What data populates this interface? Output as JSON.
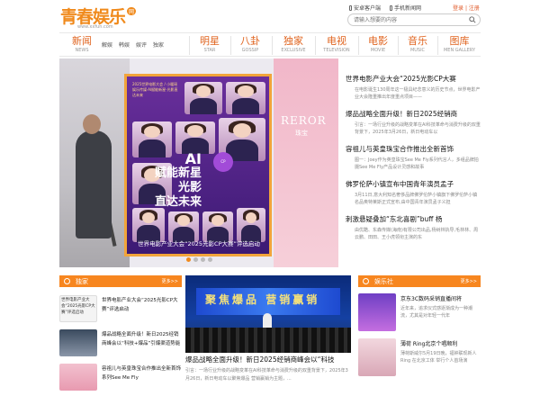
{
  "site": {
    "logo_text": "青春娱乐",
    "logo_badge": "网",
    "logo_url": "www.xxfun.com"
  },
  "topnav": {
    "android_client": "安卓客户端",
    "mobile_news": "手机新闻网",
    "login": "登录",
    "register": "注册"
  },
  "search": {
    "placeholder": "请输入想要的内容"
  },
  "mainnav": {
    "items": [
      {
        "zh": "新闻",
        "en": "NEWS"
      },
      {
        "zh": "明星",
        "en": "STAR"
      },
      {
        "zh": "八卦",
        "en": "GOSSIP"
      },
      {
        "zh": "独家",
        "en": "EXCLUSIVE"
      },
      {
        "zh": "电视",
        "en": "TELEVISION"
      },
      {
        "zh": "电影",
        "en": "MOVIE"
      },
      {
        "zh": "音乐",
        "en": "MUSIC"
      },
      {
        "zh": "图库",
        "en": "MEN GALLERY"
      }
    ],
    "subitems": [
      "解娱",
      "韩娱",
      "娱评",
      "独家"
    ]
  },
  "hero": {
    "poster_header": "2025世界电影大会 / 小暖瑶娱乐传媒·AI赋能新星·光影直达未来",
    "ai_line1": "AI",
    "ai_line2": "赋能新星",
    "ai_line3": "光影",
    "ai_line4": "直达未来",
    "right_logo": "REROR",
    "right_logo_sub": "珠宝",
    "caption": "世界电影产业大会“2025光影CP大赛”评选启动"
  },
  "news": [
    {
      "title": "世界电影产业大会“2025光影CP大赛",
      "desc": "在电影诞生130周年这一极具纪念意义的历史节点，世界电影产业大会隆重推出年度重点项目——"
    },
    {
      "title": "爆品战略全面升级！新日2025经销商",
      "desc": "引言：一场行业升级的战略变革在AI科技革命与消费升级的双重背景下，2025年3月26日，新日电动车以"
    },
    {
      "title": "容祖儿与英皇珠宝合作推出全新首饰",
      "desc": "图一：Joey作为英皇珠宝See Me Fly系列代言人，多组品牌拍摄See Me Fly产品设计灵感和故事"
    },
    {
      "title": "佛罗伦萨小镇宣布中国青年演员孟子",
      "desc": "3月11日,意大利知名奢侈品牌佛罗伦萨小镇旗下佛罗伦萨小镇名品奥特莱斯正式宣布,由中国青年演员孟子义担"
    },
    {
      "title": "刺激悬疑叠加“东北喜剧”buff 杨",
      "desc": "由优酷、东森传媒(海南)有限公司出品,杨树林执导,毛林林、周云鹏、田田、王小虎领衔主演的东"
    }
  ],
  "exclusive": {
    "title": "独家",
    "more": "更多>>",
    "items": [
      {
        "thumb_caption": "世界电影产业大会“2025光影CP大赛”评选启动",
        "title": "世界电影产业大会“2025光影CP大赛”评选启动"
      },
      {
        "thumb_caption": "",
        "title": "爆品战略全面升级！新日2025经销商峰会以“科技+爆品”引爆渠道势能"
      },
      {
        "thumb_caption": "",
        "title": "容祖儿与英皇珠宝合作推出全新首饰系列See Me Fly"
      }
    ]
  },
  "middle": {
    "stage_text": "聚焦爆品",
    "stage_text2": "营销赢销",
    "title": "爆品战略全面升级！新日2025经销商峰会以“科技",
    "desc": "引言：一场行业升级的战略变革在AI科技革命与消费升级的双重背景下，2025年3月26日，新日电动车以聚焦爆品 营销赢销为主题，..."
  },
  "fun": {
    "title": "娱乐社",
    "more": "更多>>",
    "items": [
      {
        "title": "京东3C数码采销直播间将",
        "desc": "近年来，追求仪式感逐渐成为一种潮流，尤其是对年轻一代年"
      },
      {
        "title": "薄荷 Ring北京个唱顺利",
        "desc": "薄荷斯威尔5月19日晚，福钟联现新人 Ring 在北京工体 举行个人首场演"
      }
    ]
  },
  "colors": {
    "accent": "#f08a1c",
    "panel_head": "#f7861f",
    "nav_text": "#e0641f"
  }
}
